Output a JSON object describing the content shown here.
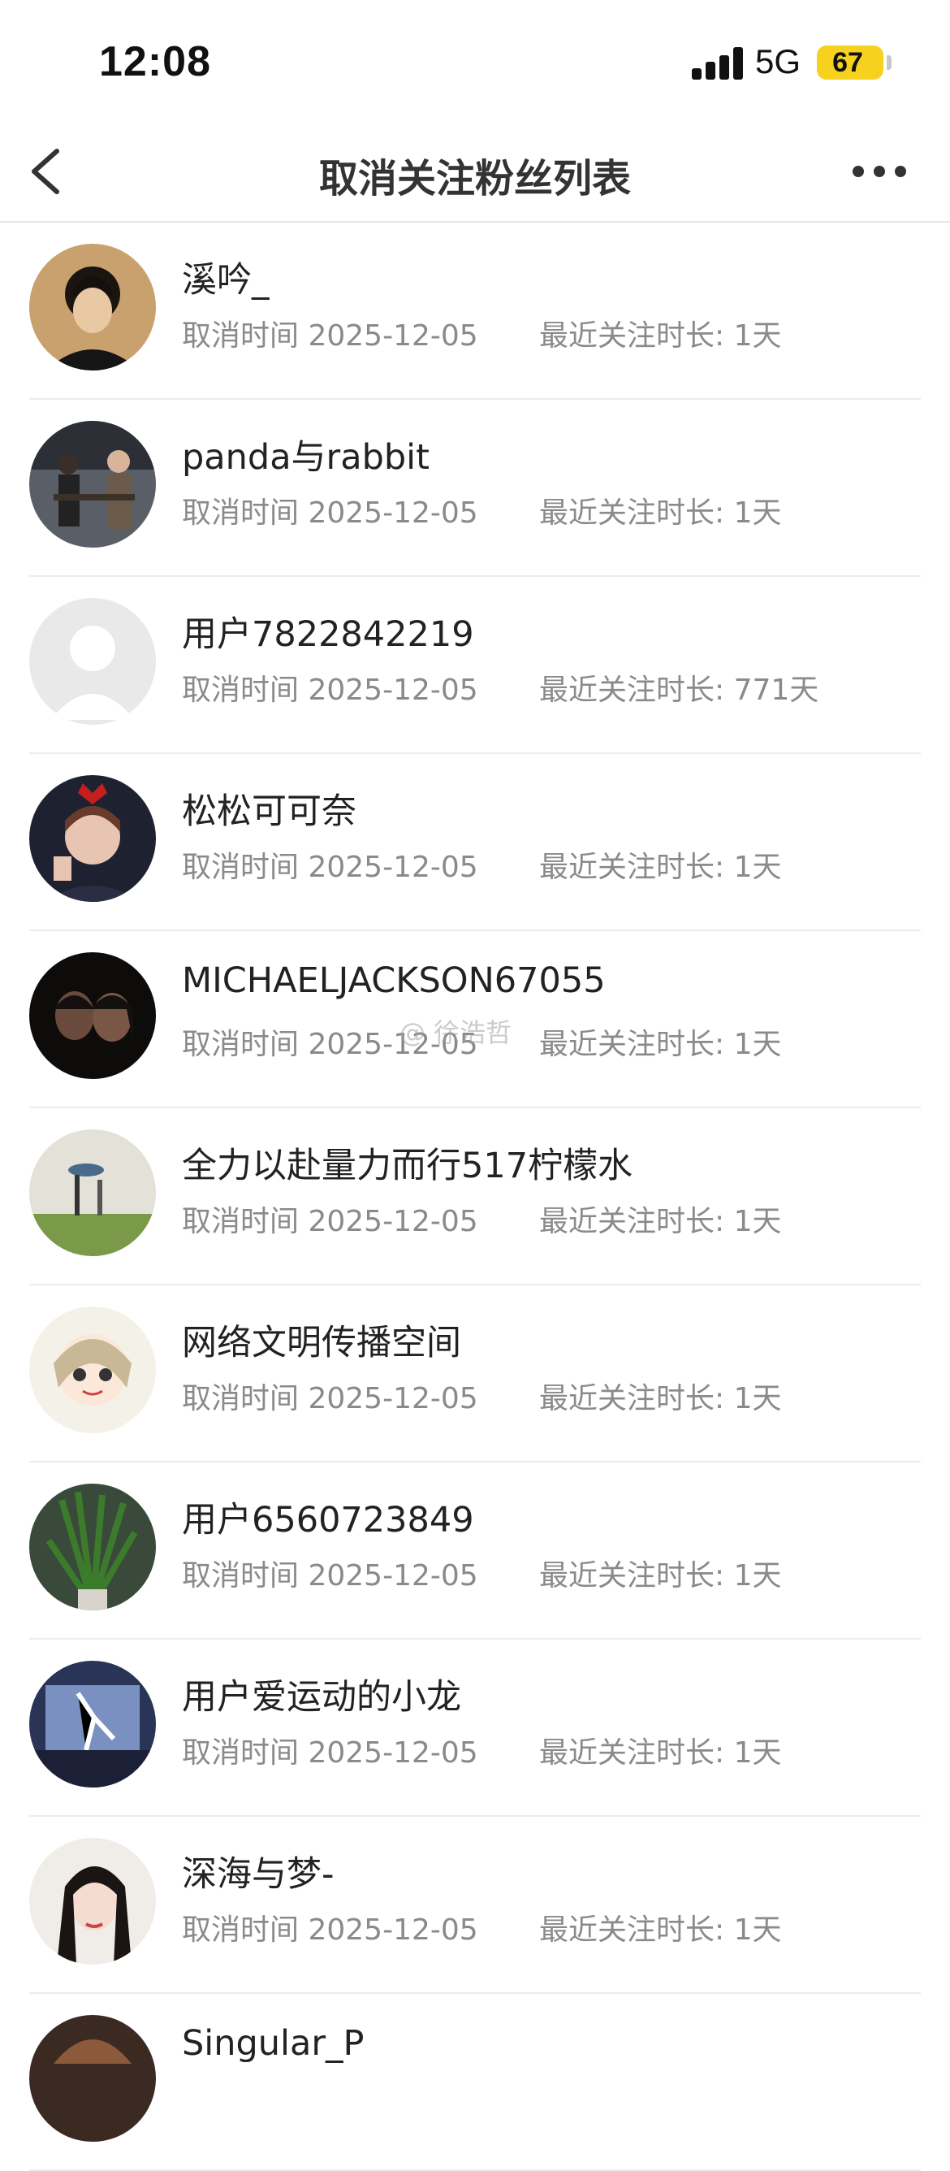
{
  "status_bar": {
    "time": "12:08",
    "network": "5G",
    "battery": "67"
  },
  "nav": {
    "title": "取消关注粉丝列表"
  },
  "list": {
    "cancel_prefix": "取消时间",
    "duration_prefix": "最近关注时长:",
    "items": [
      {
        "name": "溪吟_",
        "cancel_date": "2025-12-05",
        "duration": "1天"
      },
      {
        "name": "panda与rabbit",
        "cancel_date": "2025-12-05",
        "duration": "1天"
      },
      {
        "name": "用户7822842219",
        "cancel_date": "2025-12-05",
        "duration": "771天"
      },
      {
        "name": "松松可可奈",
        "cancel_date": "2025-12-05",
        "duration": "1天"
      },
      {
        "name": "MICHAELJACKSON67055",
        "cancel_date": "2025-12-05",
        "duration": "1天"
      },
      {
        "name": "全力以赴量力而行517柠檬水",
        "cancel_date": "2025-12-05",
        "duration": "1天"
      },
      {
        "name": "网络文明传播空间",
        "cancel_date": "2025-12-05",
        "duration": "1天"
      },
      {
        "name": "用户6560723849",
        "cancel_date": "2025-12-05",
        "duration": "1天"
      },
      {
        "name": "用户爱运动的小龙",
        "cancel_date": "2025-12-05",
        "duration": "1天"
      },
      {
        "name": "深海与梦-",
        "cancel_date": "2025-12-05",
        "duration": "1天"
      },
      {
        "name": "Singular_P",
        "cancel_date": "",
        "duration": ""
      }
    ]
  },
  "watermark": "@ 徐浩哲",
  "colors": {
    "battery": "#f6d21f",
    "divider": "#ececec",
    "meta_text": "#8a8a8a"
  }
}
